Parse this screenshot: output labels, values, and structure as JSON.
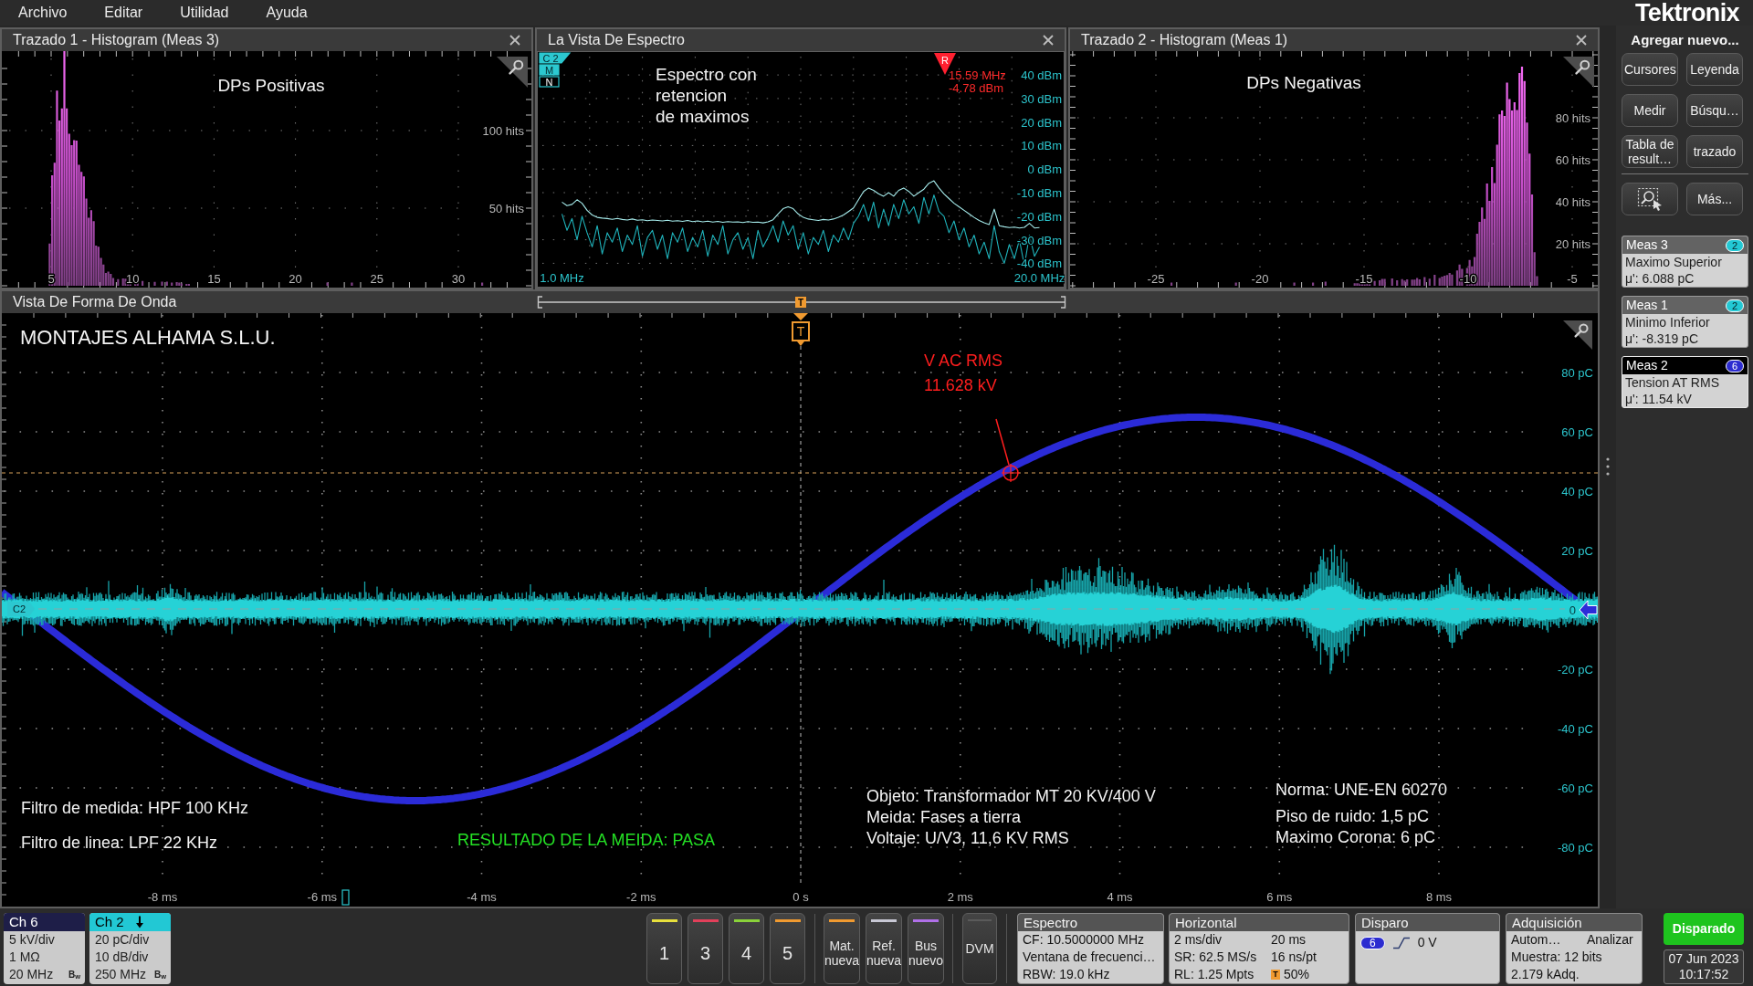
{
  "menu_bar": {
    "items": [
      {
        "label": "Archivo"
      },
      {
        "label": "Editar"
      },
      {
        "label": "Utilidad"
      },
      {
        "label": "Ayuda"
      }
    ],
    "logo": "Tektronix"
  },
  "histogram_1": {
    "title": "Trazado 1 - Histogram (Meas 3)",
    "caption": "DPs Positivas",
    "y_labels": [
      "100 hits",
      "50 hits"
    ],
    "x_labels": [
      "5",
      "10",
      "15",
      "20",
      "25",
      "30"
    ]
  },
  "spectrum": {
    "title": "La Vista De Espectro",
    "tags": [
      {
        "label": "C 2",
        "highlighted": true
      },
      {
        "label": "M",
        "highlighted": true
      },
      {
        "label": "N",
        "highlighted": false
      }
    ],
    "caption": [
      "Espectro con",
      "retencion",
      "de maximos"
    ],
    "marker": {
      "label": "R",
      "frequency": "15.59 MHz",
      "power": "-4.78 dBm"
    },
    "chart_data": {
      "type": "line",
      "grid": true,
      "x": [
        1,
        1.2,
        1.4,
        1.6,
        1.8,
        2,
        2.2,
        2.4,
        2.6,
        2.8,
        3,
        3.2,
        3.4,
        3.6,
        3.8,
        4,
        4.2,
        4.4,
        4.6,
        4.8,
        5,
        5.2,
        5.4,
        5.6,
        5.8,
        6,
        6.2,
        6.4,
        6.6,
        6.8,
        7,
        7.2,
        7.4,
        7.6,
        7.8,
        8,
        8.2,
        8.4,
        8.6,
        8.8,
        9,
        9.2,
        9.4,
        9.6,
        9.8,
        10,
        10.2,
        10.4,
        10.6,
        10.8,
        11,
        11.2,
        11.4,
        11.6,
        11.8,
        12,
        12.2,
        12.4,
        12.6,
        12.8,
        13,
        13.2,
        13.4,
        13.6,
        13.8,
        14,
        14.2,
        14.4,
        14.6,
        14.8,
        15,
        15.2,
        15.4,
        15.6,
        15.8,
        16,
        16.2,
        16.4,
        16.6,
        16.8,
        17,
        17.2,
        17.4,
        17.6,
        17.8,
        18,
        18.2,
        18.4,
        18.6,
        18.8,
        19,
        19.2,
        19.4,
        19.6,
        19.8,
        20
      ],
      "series": [
        {
          "color": "#1fb3bb",
          "values": [
            -19,
            -26,
            -21,
            -30,
            -20,
            -27,
            -33,
            -24,
            -36,
            -27,
            -31,
            -25,
            -35,
            -28,
            -32,
            -24,
            -37,
            -29,
            -26,
            -34,
            -28,
            -38,
            -27,
            -31,
            -25,
            -35,
            -29,
            -33,
            -26,
            -37,
            -28,
            -32,
            -24,
            -36,
            -30,
            -27,
            -34,
            -29,
            -38,
            -26,
            -33,
            -29,
            -24,
            -31,
            -22,
            -28,
            -24,
            -34,
            -27,
            -36,
            -29,
            -32,
            -26,
            -35,
            -28,
            -31,
            -25,
            -30,
            -23,
            -20,
            -15,
            -22,
            -14,
            -25,
            -17,
            -24,
            -15,
            -21,
            -13,
            -19,
            -16,
            -23,
            -12,
            -19,
            -11,
            -18,
            -20,
            -27,
            -22,
            -30,
            -25,
            -33,
            -28,
            -36,
            -31,
            -38,
            -24,
            -35,
            -40,
            -32,
            -38,
            -30,
            -41,
            -28,
            -37,
            -33
          ]
        },
        {
          "color": "#a6ecec",
          "values": [
            -14,
            -15.5,
            -15,
            -13,
            -14.5,
            -17.5,
            -19.5,
            -20.5,
            -20.8,
            -21,
            -21.3,
            -20.9,
            -21.4,
            -21.6,
            -21.2,
            -21.7,
            -21.5,
            -21.9,
            -21.6,
            -21.8,
            -22,
            -21.7,
            -22.1,
            -21.9,
            -22.2,
            -21.8,
            -22.3,
            -22,
            -22.4,
            -22.1,
            -22.5,
            -22.2,
            -22.6,
            -22.3,
            -22.5,
            -22.4,
            -22.7,
            -22.3,
            -22.6,
            -22.5,
            -22.8,
            -22.4,
            -21.5,
            -19,
            -16.8,
            -16,
            -16.8,
            -19,
            -20.5,
            -21.2,
            -21.5,
            -21.8,
            -21.4,
            -21.6,
            -21.2,
            -20.5,
            -19.5,
            -18,
            -16.5,
            -13,
            -9.5,
            -8,
            -9,
            -10.5,
            -11.5,
            -10,
            -11.5,
            -9,
            -8,
            -9.5,
            -11.5,
            -10,
            -8.5,
            -6,
            -5,
            -8,
            -10.5,
            -12.5,
            -14.5,
            -16,
            -17.5,
            -19,
            -20.5,
            -21.8,
            -22.8,
            -23.5,
            -17,
            -24,
            -24.5,
            -24.8,
            -24.6,
            -25,
            -24.7,
            -23,
            -25,
            -24.8
          ]
        }
      ],
      "xlim": [
        0,
        21
      ],
      "ylim": [
        -50.3,
        50.1
      ],
      "xticks": [
        {
          "value": 1,
          "label": "1.0 MHz"
        },
        {
          "value": 20,
          "label": "20.0 MHz"
        }
      ],
      "yticks": [
        {
          "value": 40,
          "label": "40 dBm"
        },
        {
          "value": 30,
          "label": "30 dBm"
        },
        {
          "value": 20,
          "label": "20 dBm"
        },
        {
          "value": 10,
          "label": "10 dBm"
        },
        {
          "value": 0,
          "label": "0 dBm"
        },
        {
          "value": -10,
          "label": "-10 dBm"
        },
        {
          "value": -20,
          "label": "-20 dBm"
        },
        {
          "value": -30,
          "label": "-30 dBm"
        },
        {
          "value": -40,
          "label": "-40 dBm"
        }
      ]
    }
  },
  "histogram_2": {
    "title": "Trazado 2 - Histogram (Meas 1)",
    "caption": "DPs Negativas",
    "y_labels": [
      "80 hits",
      "60 hits",
      "40 hits",
      "20 hits"
    ],
    "x_labels": [
      "-25",
      "-20",
      "-15",
      "-10",
      "-5"
    ]
  },
  "waveform": {
    "title": "Vista De Forma De Onda",
    "overview_marker": "T",
    "trigger_marker": "T",
    "heading": "MONTAJES ALHAMA S.L.U.",
    "readout": [
      "V AC RMS",
      "11.628 kV"
    ],
    "channel_tag": "C2",
    "y_labels": [
      "80 pC",
      "60 pC",
      "40 pC",
      "20 pC",
      "0",
      "-20 pC",
      "-40 pC",
      "-60 pC",
      "-80 pC"
    ],
    "x_labels": [
      "-8 ms",
      "-6 ms",
      "-4 ms",
      "-2 ms",
      "0 s",
      "2 ms",
      "4 ms",
      "6 ms",
      "8 ms"
    ],
    "filters": [
      "Filtro de medida: HPF 100 KHz",
      "Filtro de linea: LPF 22 KHz"
    ],
    "result": "RESULTADO DE LA MEIDA: PASA",
    "test_object": [
      "Objeto: Transformador MT 20 KV/400 V",
      "Meida: Fases a tierra",
      "Voltaje: U/V3, 11,6 KV RMS"
    ],
    "standard": [
      "Norma: UNE-EN 60270",
      "Piso de ruido: 1,5 pC",
      "Maximo Corona: 6 pC"
    ]
  },
  "sidebar": {
    "title": "Agregar nuevo...",
    "buttons": [
      {
        "label": "Cursores"
      },
      {
        "label": "Leyenda"
      },
      {
        "label": "Medir"
      },
      {
        "label": "Búsqu…"
      },
      {
        "label": "Tabla de result…"
      },
      {
        "label": "trazado"
      }
    ],
    "tools": [
      {
        "kind": "icon"
      },
      {
        "kind": "text",
        "label": "Más..."
      }
    ],
    "measurements": [
      {
        "title": "Meas 3",
        "badge": "2",
        "color": "#22c8d4",
        "selected": false,
        "name": "Maximo Superior",
        "value": "μ': 6.088 pC"
      },
      {
        "title": "Meas 1",
        "badge": "2",
        "color": "#22c8d4",
        "selected": false,
        "name": "Minimo Inferior",
        "value": "μ': -8.319 pC"
      },
      {
        "title": "Meas 2",
        "badge": "6",
        "color": "#2c2cd0",
        "selected": true,
        "name": "Tension AT RMS",
        "value": "μ': 11.54 kV"
      }
    ]
  },
  "bottom_bar": {
    "channels": [
      {
        "name": "Ch 6",
        "color": "#1e1e48",
        "selected": false,
        "settings": [
          "5 kV/div",
          "1 MΩ",
          "20 MHz"
        ],
        "bw_mark": "B$_{w}$"
      },
      {
        "name": "Ch 2",
        "color": "#22c8d4",
        "selected": true,
        "settings": [
          "20 pC/div",
          "10 dB/div",
          "250 MHz"
        ],
        "bw_mark": "B$_{w}$"
      }
    ],
    "channel_buttons": [
      {
        "label": "1",
        "color": "#e8e03c"
      },
      {
        "label": "3",
        "color": "#e2405a"
      },
      {
        "label": "4",
        "color": "#8ad23a"
      },
      {
        "label": "5",
        "color": "#f09a30"
      }
    ],
    "add_buttons": [
      {
        "lines": [
          "Mat.",
          "nueva"
        ],
        "color": "#f09a30"
      },
      {
        "lines": [
          "Ref.",
          "nueva"
        ],
        "color": "#c8c8d4"
      },
      {
        "lines": [
          "Bus",
          "nuevo"
        ],
        "color": "#b070e8"
      }
    ],
    "dvm_button": "DVM",
    "spectrum_panel": {
      "title": "Espectro",
      "lines": [
        "CF: 10.5000000 MHz",
        "Ventana de frecuenci…",
        "RBW: 19.0 kHz"
      ]
    },
    "horizontal_panel": {
      "title": "Horizontal",
      "rows": [
        [
          "2 ms/div",
          "20 ms"
        ],
        [
          "SR: 62.5 MS/s",
          "16 ns/pt"
        ],
        [
          "RL: 1.25 Mpts",
          "50%"
        ]
      ],
      "position_marker": "T"
    },
    "trigger_panel": {
      "title": "Disparo",
      "source": "6",
      "threshold": "0 V"
    },
    "acquisition_panel": {
      "title": "Adquisición",
      "rows": [
        [
          "Autom…",
          "Analizar"
        ],
        [
          "Muestra: 12 bits"
        ],
        [
          "2.179 kAdq."
        ]
      ]
    },
    "run_status": "Disparado",
    "date": "07 Jun 2023",
    "time": "10:17:52"
  }
}
